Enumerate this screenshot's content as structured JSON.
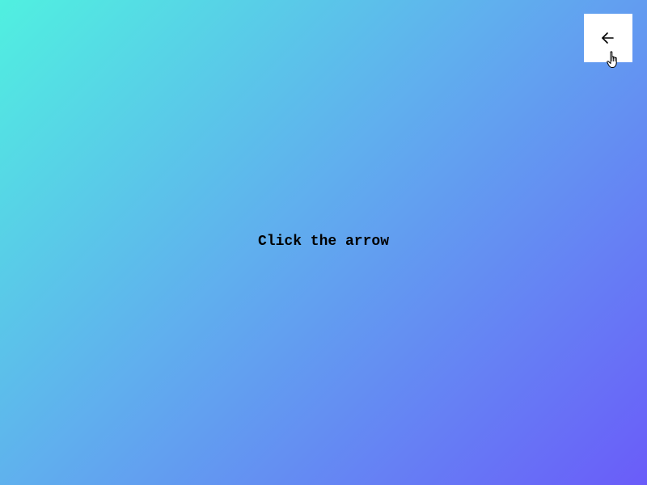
{
  "instruction": {
    "text": "Click the arrow"
  },
  "arrow_button": {
    "icon": "arrow-left-icon",
    "background": "#FFFFFF"
  },
  "cursor": {
    "icon": "hand-pointer-icon"
  },
  "background": {
    "gradient_start": "#50F0E0",
    "gradient_end": "#6A5CF9"
  }
}
